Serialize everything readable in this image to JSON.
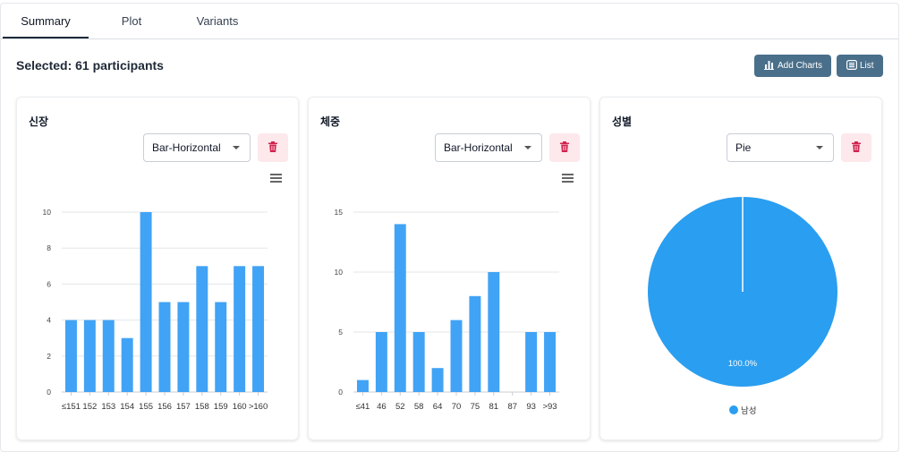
{
  "tabs": [
    {
      "label": "Summary",
      "active": true
    },
    {
      "label": "Plot",
      "active": false
    },
    {
      "label": "Variants",
      "active": false
    }
  ],
  "header": {
    "selected_text": "Selected: 61 participants",
    "add_charts_label": "Add Charts",
    "list_label": "List"
  },
  "colors": {
    "bar": "#41a3f5",
    "pie": "#2a9ef0",
    "button": "#4a6f8a",
    "delete_bg": "#fde8ec",
    "delete_icon": "#d0234f"
  },
  "cards": [
    {
      "title": "신장",
      "select_value": "Bar-Horizontal",
      "menu_icon": "hamburger-icon",
      "delete_icon": "trash-icon"
    },
    {
      "title": "체중",
      "select_value": "Bar-Horizontal",
      "menu_icon": "hamburger-icon",
      "delete_icon": "trash-icon"
    },
    {
      "title": "성별",
      "select_value": "Pie",
      "delete_icon": "trash-icon"
    }
  ],
  "chart_data": [
    {
      "type": "bar",
      "categories": [
        "≤151",
        "152",
        "153",
        "154",
        "155",
        "156",
        "157",
        "158",
        "159",
        "160",
        ">160"
      ],
      "values": [
        4,
        4,
        4,
        3,
        10,
        5,
        5,
        7,
        5,
        7,
        7
      ],
      "yticks": [
        0,
        2,
        4,
        6,
        8,
        10
      ],
      "ylim": [
        0,
        10
      ],
      "grid": true
    },
    {
      "type": "bar",
      "categories": [
        "≤41",
        "46",
        "52",
        "58",
        "64",
        "70",
        "75",
        "81",
        "87",
        "93",
        ">93"
      ],
      "values": [
        1,
        5,
        14,
        5,
        2,
        6,
        8,
        10,
        0,
        5,
        5
      ],
      "yticks": [
        0,
        5,
        10,
        15
      ],
      "ylim": [
        0,
        15
      ],
      "grid": true
    },
    {
      "type": "pie",
      "slices": [
        {
          "label": "남성",
          "value": 100.0,
          "display": "100.0%"
        }
      ],
      "legend": "bottom"
    }
  ]
}
